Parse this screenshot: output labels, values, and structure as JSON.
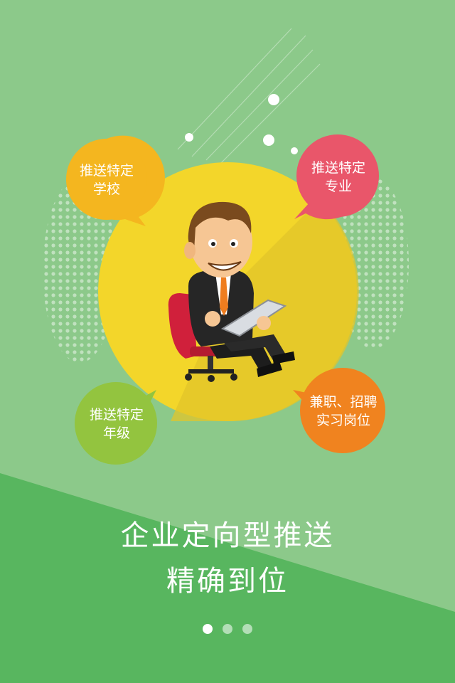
{
  "colors": {
    "background": "#8cc98a",
    "lower_band": "#58b65f",
    "yellow_circle": "#f3d62a",
    "bubble_school": "#f4b61f",
    "bubble_major": "#e9566a",
    "bubble_grade": "#93c43f",
    "bubble_jobs": "#f0831f"
  },
  "illustration": {
    "subject": "businessman-with-tablet-icon"
  },
  "bubbles": {
    "school": {
      "line1": "推送特定",
      "line2": "学校"
    },
    "major": {
      "line1": "推送特定",
      "line2": "专业"
    },
    "grade": {
      "line1": "推送特定",
      "line2": "年级"
    },
    "jobs": {
      "line1": "兼职、招聘",
      "line2": "实习岗位"
    }
  },
  "headline": {
    "line1": "企业定向型推送",
    "line2": "精确到位"
  },
  "pager": {
    "total_pages": 3,
    "active_page": 1
  }
}
